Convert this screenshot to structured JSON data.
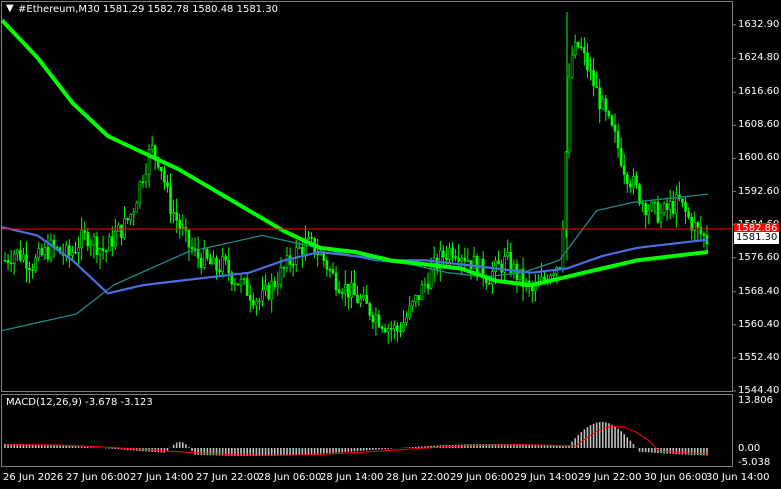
{
  "header": {
    "menu_glyph": "▼",
    "title": "#Ethereum,M30",
    "ohlc": "1581.29 1582.78 1580.48 1581.30"
  },
  "price_axis": {
    "ticks": [
      "1632.90",
      "1624.80",
      "1616.60",
      "1608.60",
      "1600.60",
      "1592.60",
      "1584.60",
      "1576.60",
      "1568.40",
      "1560.40",
      "1552.40",
      "1544.40"
    ]
  },
  "price_tags": {
    "red": {
      "label": "1582.86",
      "bg": "#ff0000",
      "color": "#ffffff"
    },
    "current": {
      "label": "1581.30",
      "bg": "#ffffff",
      "color": "#000000"
    }
  },
  "macd": {
    "label": "MACD(12,26,9) -3.678 -3.123",
    "ticks": [
      "13.806",
      "0.00",
      "-5.038"
    ]
  },
  "time_axis": {
    "labels": [
      "26 Jun 2026",
      "27 Jun 06:00",
      "27 Jun 14:00",
      "27 Jun 22:00",
      "28 Jun 06:00",
      "28 Jun 14:00",
      "28 Jun 22:00",
      "29 Jun 06:00",
      "29 Jun 14:00",
      "29 Jun 22:00",
      "30 Jun 06:00",
      "30 Jun 14:00"
    ]
  },
  "colors": {
    "background": "#000000",
    "candle": "#00ff00",
    "ma_slow": "#00ff00",
    "ma_mid": "#4a6fe0",
    "ma_fast": "#208a8a",
    "red_line": "#ff0000",
    "macd_hist": "#c0c0c0",
    "macd_signal": "#ff0000",
    "grid_text": "#ffffff"
  },
  "chart_data": {
    "type": "candlestick",
    "symbol": "#Ethereum",
    "timeframe": "M30",
    "ylim": [
      1544.4,
      1636.0
    ],
    "x_ticks": [
      "26 Jun 2026",
      "27 Jun 06:00",
      "27 Jun 14:00",
      "27 Jun 22:00",
      "28 Jun 06:00",
      "28 Jun 14:00",
      "28 Jun 22:00",
      "29 Jun 06:00",
      "29 Jun 14:00",
      "29 Jun 22:00",
      "30 Jun 06:00",
      "30 Jun 14:00"
    ],
    "close_path": [
      1576,
      1578,
      1577,
      1575,
      1577,
      1579,
      1578,
      1577,
      1580,
      1582,
      1580,
      1578,
      1582,
      1584,
      1588,
      1596,
      1603,
      1600,
      1590,
      1585,
      1580,
      1577,
      1576,
      1574,
      1575,
      1572,
      1570,
      1568,
      1566,
      1569,
      1572,
      1575,
      1578,
      1580,
      1579,
      1576,
      1572,
      1570,
      1568,
      1566,
      1564,
      1562,
      1560,
      1559,
      1562,
      1566,
      1570,
      1574,
      1577,
      1579,
      1578,
      1576,
      1574,
      1572,
      1574,
      1576,
      1573,
      1570,
      1568,
      1571,
      1574,
      1576,
      1625,
      1628,
      1622,
      1616,
      1610,
      1605,
      1598,
      1594,
      1590,
      1588,
      1587,
      1589,
      1590,
      1586,
      1583,
      1581
    ],
    "ma_slow": [
      1634,
      1625,
      1614,
      1606,
      1602,
      1598,
      1593,
      1588,
      1583,
      1579,
      1578,
      1576,
      1575,
      1574,
      1571,
      1570,
      1572,
      1574,
      1576,
      1577,
      1578
    ],
    "ma_mid": [
      1584,
      1582,
      1576,
      1568,
      1570,
      1571,
      1572,
      1573,
      1576,
      1578,
      1577,
      1576,
      1576,
      1575,
      1574,
      1573,
      1574,
      1577,
      1579,
      1580,
      1581
    ],
    "ma_fast": [
      1559,
      1561,
      1563,
      1570,
      1574,
      1578,
      1580,
      1582,
      1580,
      1578,
      1576,
      1575,
      1573,
      1572,
      1573,
      1576,
      1588,
      1590,
      1591,
      1592
    ]
  }
}
